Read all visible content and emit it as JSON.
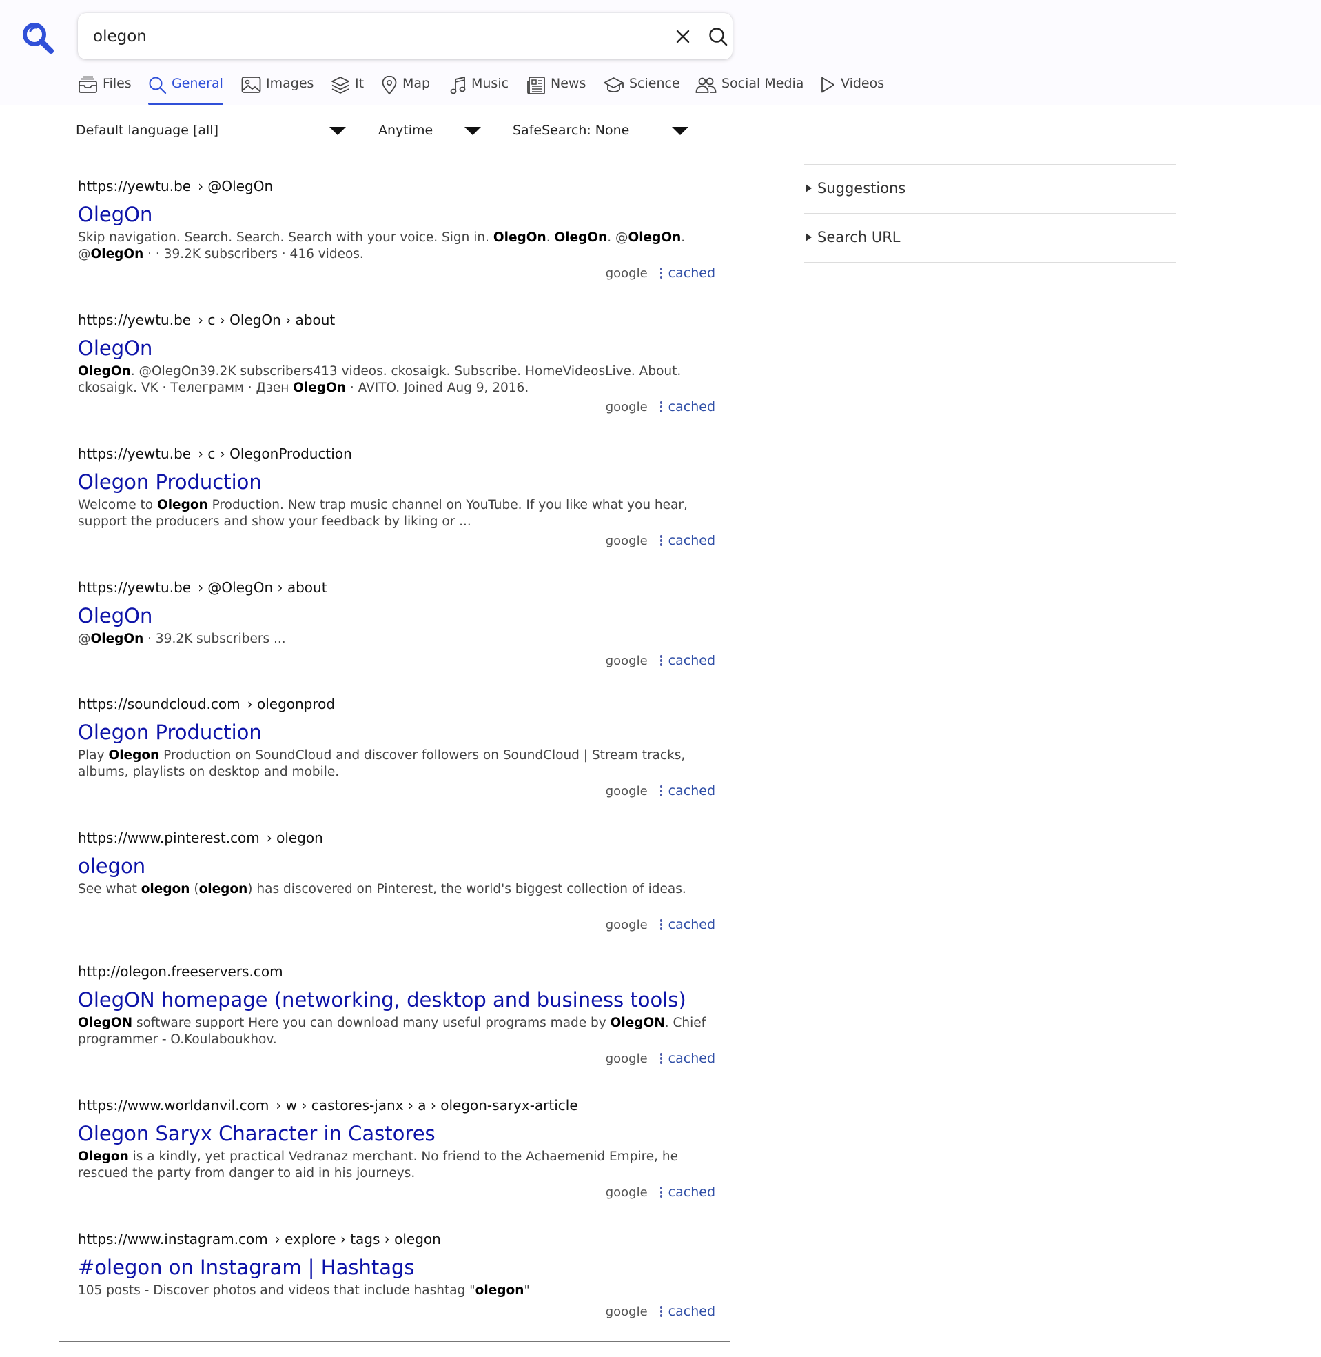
{
  "search": {
    "value": "olegon"
  },
  "tabs": [
    {
      "label": "Files",
      "icon": "files-icon"
    },
    {
      "label": "General",
      "icon": "search-icon",
      "active": true
    },
    {
      "label": "Images",
      "icon": "image-icon"
    },
    {
      "label": "It",
      "icon": "layers-icon"
    },
    {
      "label": "Map",
      "icon": "map-pin-icon"
    },
    {
      "label": "Music",
      "icon": "music-note-icon"
    },
    {
      "label": "News",
      "icon": "newspaper-icon"
    },
    {
      "label": "Science",
      "icon": "graduation-cap-icon"
    },
    {
      "label": "Social Media",
      "icon": "people-icon"
    },
    {
      "label": "Videos",
      "icon": "play-icon"
    }
  ],
  "filters": {
    "language": "Default language [all]",
    "time": "Anytime",
    "safesearch": "SafeSearch: None"
  },
  "results": [
    {
      "host": "https://yewtu.be",
      "path": "› @OlegOn",
      "title": "OlegOn",
      "snippet": [
        {
          "t": "Skip navigation. Search. Search. Search with your voice. Sign in. "
        },
        {
          "t": "OlegOn",
          "b": true
        },
        {
          "t": ". "
        },
        {
          "t": "OlegOn",
          "b": true
        },
        {
          "t": ". @"
        },
        {
          "t": "OlegOn",
          "b": true
        },
        {
          "t": ". @"
        },
        {
          "t": "OlegOn",
          "b": true
        },
        {
          "t": " · · 39.2K subscribers · 416 videos."
        }
      ],
      "engine": "google",
      "cached": "cached"
    },
    {
      "host": "https://yewtu.be",
      "path": "› c › OlegOn › about",
      "title": "OlegOn",
      "snippet": [
        {
          "t": "OlegOn",
          "b": true
        },
        {
          "t": ". @OlegOn39.2K subscribers413 videos. ckosaigk. Subscribe. HomeVideosLive. About. ckosaigk. VK · Телеграмм · Дзен "
        },
        {
          "t": "OlegOn",
          "b": true
        },
        {
          "t": " · AVITO. Joined Aug 9, 2016."
        }
      ],
      "engine": "google",
      "cached": "cached"
    },
    {
      "host": "https://yewtu.be",
      "path": "› c › OlegonProduction",
      "title": "Olegon Production",
      "snippet": [
        {
          "t": "Welcome to "
        },
        {
          "t": "Olegon",
          "b": true
        },
        {
          "t": " Production. New trap music channel on YouTube. If you like what you hear, support the producers and show your feedback by liking or ..."
        }
      ],
      "engine": "google",
      "cached": "cached"
    },
    {
      "host": "https://yewtu.be",
      "path": "› @OlegOn › about",
      "title": "OlegOn",
      "snippet": [
        {
          "t": "@"
        },
        {
          "t": "OlegOn",
          "b": true
        },
        {
          "t": " · 39.2K subscribers ..."
        }
      ],
      "engine": "google",
      "cached": "cached"
    },
    {
      "host": "https://soundcloud.com",
      "path": "› olegonprod",
      "title": "Olegon Production",
      "snippet": [
        {
          "t": "Play "
        },
        {
          "t": "Olegon",
          "b": true
        },
        {
          "t": " Production on SoundCloud and discover followers on SoundCloud | Stream tracks, albums, playlists on desktop and mobile."
        }
      ],
      "engine": "google",
      "cached": "cached"
    },
    {
      "host": "https://www.pinterest.com",
      "path": "› olegon",
      "title": "olegon",
      "snippet": [
        {
          "t": "See what "
        },
        {
          "t": "olegon",
          "b": true
        },
        {
          "t": " ("
        },
        {
          "t": "olegon",
          "b": true
        },
        {
          "t": ") has discovered on Pinterest, the world's biggest collection of ideas."
        }
      ],
      "engine": "google",
      "cached": "cached"
    },
    {
      "host": "http://olegon.freeservers.com",
      "path": "",
      "title": "OlegON homepage (networking, desktop and business tools)",
      "snippet": [
        {
          "t": "OlegON",
          "b": true
        },
        {
          "t": " software support Here you can download many useful programs made by "
        },
        {
          "t": "OlegON",
          "b": true
        },
        {
          "t": ". Chief programmer - O.Koulaboukhov."
        }
      ],
      "engine": "google",
      "cached": "cached"
    },
    {
      "host": "https://www.worldanvil.com",
      "path": "› w › castores-janx › a › olegon-saryx-article",
      "title": "Olegon Saryx Character in Castores",
      "snippet": [
        {
          "t": "Olegon",
          "b": true
        },
        {
          "t": " is a kindly, yet practical Vedranaz merchant. No friend to the Achaemenid Empire, he rescued the party from danger to aid in his journeys."
        }
      ],
      "engine": "google",
      "cached": "cached"
    },
    {
      "host": "https://www.instagram.com",
      "path": "› explore › tags › olegon",
      "title": "#olegon on Instagram | Hashtags",
      "snippet": [
        {
          "t": "105 posts - Discover photos and videos that include hashtag \""
        },
        {
          "t": "olegon",
          "b": true
        },
        {
          "t": "\""
        }
      ],
      "engine": "google",
      "cached": "cached"
    }
  ],
  "sidebar": {
    "suggestions": "Suggestions",
    "search_url": "Search URL"
  },
  "colors": {
    "accent": "#3050d8",
    "link": "#0d13a8",
    "cached": "#2f4ea6"
  }
}
